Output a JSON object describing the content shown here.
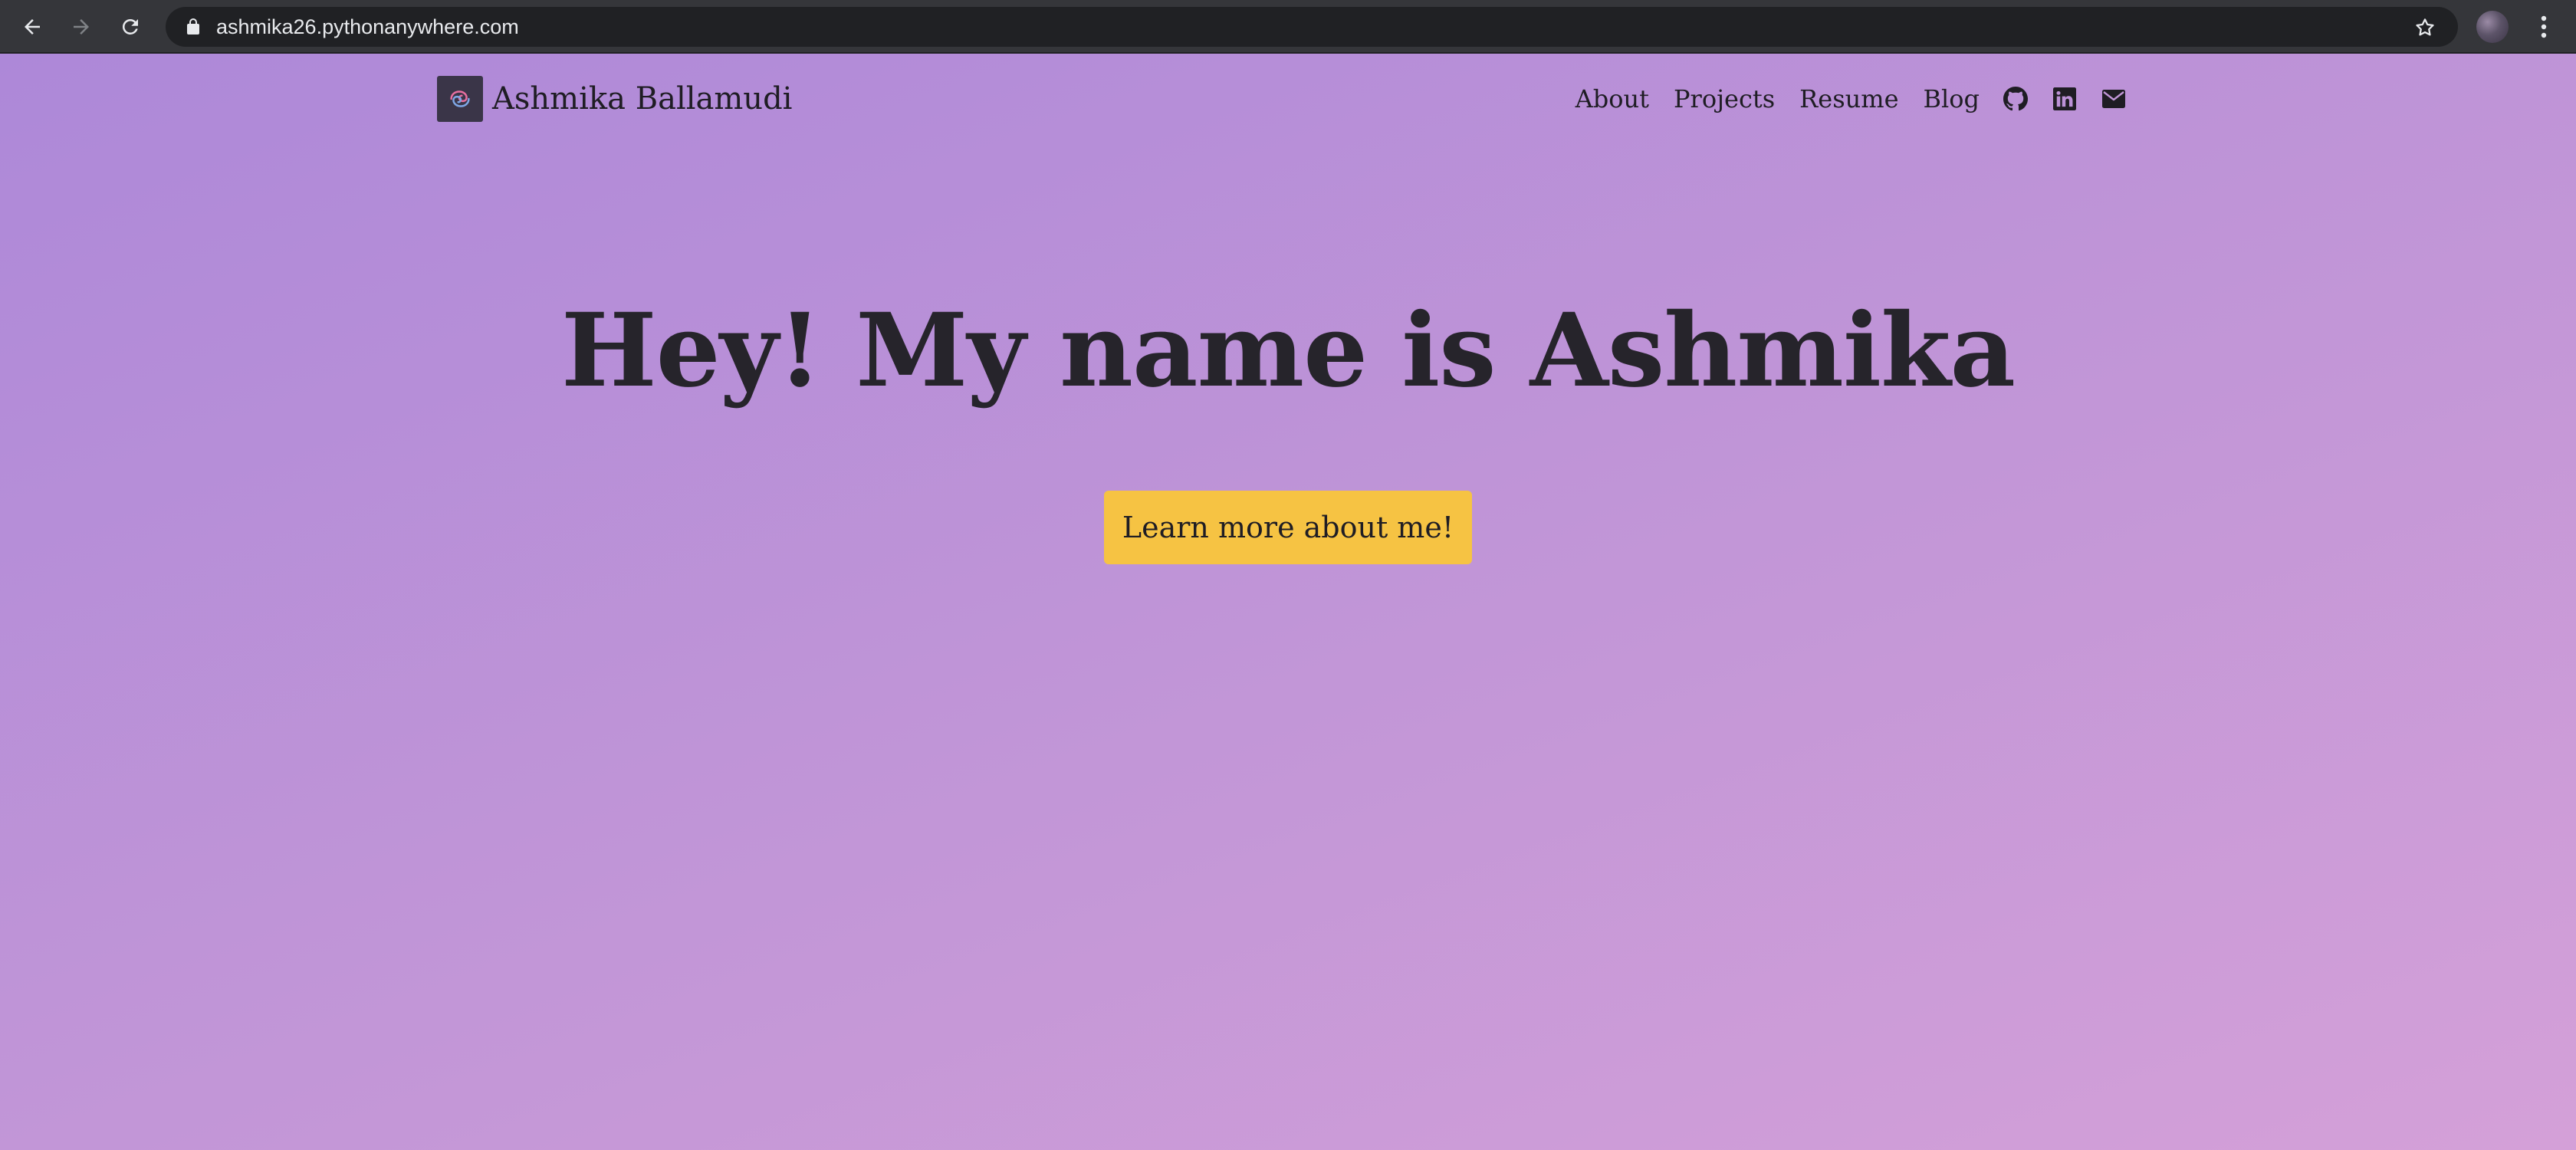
{
  "browser": {
    "url": "ashmika26.pythonanywhere.com",
    "icons": {
      "back": "arrow-left-icon",
      "forward": "arrow-right-icon",
      "reload": "reload-icon",
      "lock": "lock-icon",
      "bookmark": "star-icon",
      "menu": "kebab-menu-icon"
    }
  },
  "nav": {
    "brand_name": "Ashmika Ballamudi",
    "links": [
      {
        "label": "About"
      },
      {
        "label": "Projects"
      },
      {
        "label": "Resume"
      },
      {
        "label": "Blog"
      }
    ],
    "social_icons": [
      "github-icon",
      "linkedin-icon",
      "envelope-icon"
    ]
  },
  "hero": {
    "title": "Hey! My name is Ashmika",
    "cta_label": "Learn more about me!"
  },
  "colors": {
    "background_start": "#ad88d8",
    "background_end": "#d4a0d8",
    "cta_background": "#f6c343",
    "text": "#26242b"
  }
}
